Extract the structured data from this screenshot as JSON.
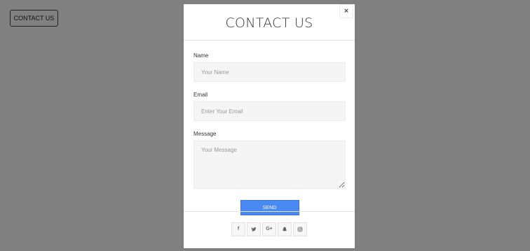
{
  "page": {
    "contact_button_label": "CONTACT US"
  },
  "modal": {
    "title": "CONTACT US",
    "close_icon": "close-icon",
    "close_glyph": "×",
    "fields": {
      "name_label": "Name",
      "name_placeholder": "Your Name",
      "email_label": "Email",
      "email_placeholder": "Enter Your Email",
      "message_label": "Message",
      "message_placeholder": "Your Message"
    },
    "send_label": "SEND",
    "social": [
      {
        "icon": "facebook-icon",
        "glyph": "f"
      },
      {
        "icon": "twitter-icon",
        "glyph": ""
      },
      {
        "icon": "google-plus-icon",
        "glyph": "G+"
      },
      {
        "icon": "snapchat-icon",
        "glyph": ""
      },
      {
        "icon": "instagram-icon",
        "glyph": ""
      }
    ]
  },
  "colors": {
    "overlay": "#808080",
    "send_button": "#4a88f2",
    "input_bg": "#f5f5f5"
  }
}
